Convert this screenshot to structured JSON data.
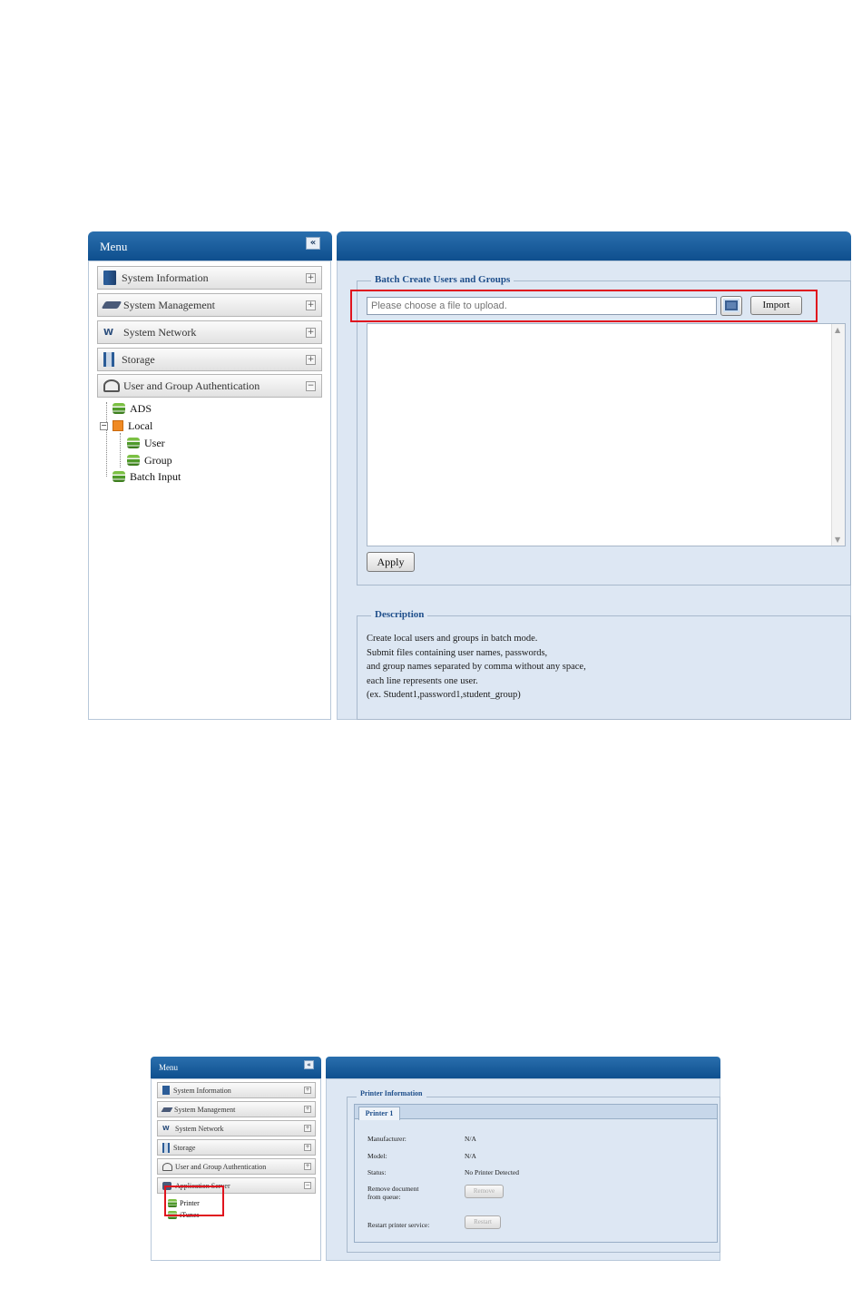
{
  "screen1": {
    "menu": {
      "title": "Menu",
      "collapse_icon": "double-chevron-left-icon",
      "items": [
        {
          "label": "System Information",
          "icon": "book-icon",
          "toggle": "+"
        },
        {
          "label": "System Management",
          "icon": "wrench-icon",
          "toggle": "+"
        },
        {
          "label": "System Network",
          "icon": "network-icon",
          "toggle": "+"
        },
        {
          "label": "Storage",
          "icon": "storage-icon",
          "toggle": "+"
        },
        {
          "label": "User and Group Authentication",
          "icon": "user-auth-icon",
          "toggle": "−"
        }
      ],
      "tree": {
        "expander": "−",
        "items": [
          {
            "label": "ADS",
            "icon": "green-stack-icon"
          },
          {
            "label": "Local",
            "icon": "orange-folder-icon"
          },
          {
            "label": "User",
            "icon": "green-stack-icon"
          },
          {
            "label": "Group",
            "icon": "green-stack-icon"
          },
          {
            "label": "Batch Input",
            "icon": "green-stack-icon"
          }
        ]
      }
    },
    "content": {
      "batch_legend": "Batch Create Users and Groups",
      "file_placeholder": "Please choose a file to upload.",
      "browse_icon": "browse-file-icon",
      "import_label": "Import",
      "textarea_value": "",
      "apply_label": "Apply",
      "description_legend": "Description",
      "description_lines": [
        "Create local users and groups in batch mode.",
        "Submit files containing user names, passwords,",
        "and group names separated by comma without any space,",
        "each line represents one user.",
        "(ex. Student1,password1,student_group)"
      ]
    }
  },
  "screen2": {
    "menu": {
      "title": "Menu",
      "collapse_icon": "double-chevron-left-icon",
      "items": [
        {
          "label": "System Information",
          "toggle": "+"
        },
        {
          "label": "System Management",
          "toggle": "+"
        },
        {
          "label": "System Network",
          "toggle": "+"
        },
        {
          "label": "Storage",
          "toggle": "+"
        },
        {
          "label": "User and Group Authentication",
          "toggle": "+"
        },
        {
          "label": "Application Server",
          "toggle": "−"
        }
      ],
      "tree": [
        {
          "label": "Printer",
          "icon": "green-stack-icon"
        },
        {
          "label": "iTunes",
          "icon": "green-stack-icon"
        }
      ]
    },
    "content": {
      "legend": "Printer Information",
      "tab_label": "Printer 1",
      "fields": [
        {
          "label": "Manufacturer:",
          "value": "N/A"
        },
        {
          "label": "Model:",
          "value": "N/A"
        },
        {
          "label": "Status:",
          "value": "No Printer Detected"
        }
      ],
      "remove_label_1": "Remove document",
      "remove_label_2": "from queue:",
      "remove_button": "Remove",
      "restart_label": "Restart printer service:",
      "restart_button": "Restart"
    }
  },
  "colors": {
    "header_blue": "#0e4f8e",
    "panel_bg": "#dde7f3",
    "highlight_red": "#e0141e",
    "legend_blue": "#1f4f8b"
  }
}
